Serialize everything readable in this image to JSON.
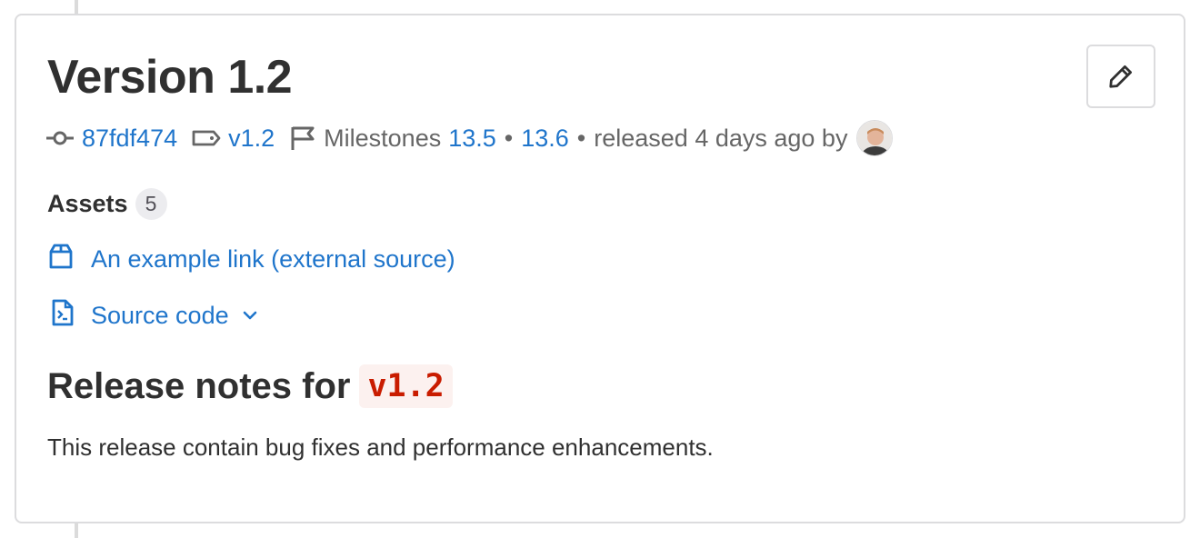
{
  "release": {
    "title": "Version 1.2",
    "commit_sha": "87fdf474",
    "tag": "v1.2",
    "milestones_label": "Milestones",
    "milestones": [
      "13.5",
      "13.6"
    ],
    "released_text": "released 4 days ago by"
  },
  "assets": {
    "title": "Assets",
    "count": "5",
    "links": [
      {
        "label": "An example link (external source)"
      }
    ],
    "source_code_label": "Source code"
  },
  "notes": {
    "heading_prefix": "Release notes for",
    "heading_code": "v1.2",
    "body": "This release contain bug fixes and performance enhancements."
  },
  "icons": {
    "commit": "commit-icon",
    "tag": "tag-icon",
    "milestone": "flag-icon",
    "edit": "pencil-icon",
    "package": "package-icon",
    "source": "doc-code-icon",
    "chevron": "chevron-down-icon"
  },
  "colors": {
    "link": "#1f75cb",
    "text": "#303030",
    "muted": "#666666",
    "code_fg": "#c91c00",
    "code_bg": "#fcf1ef"
  }
}
